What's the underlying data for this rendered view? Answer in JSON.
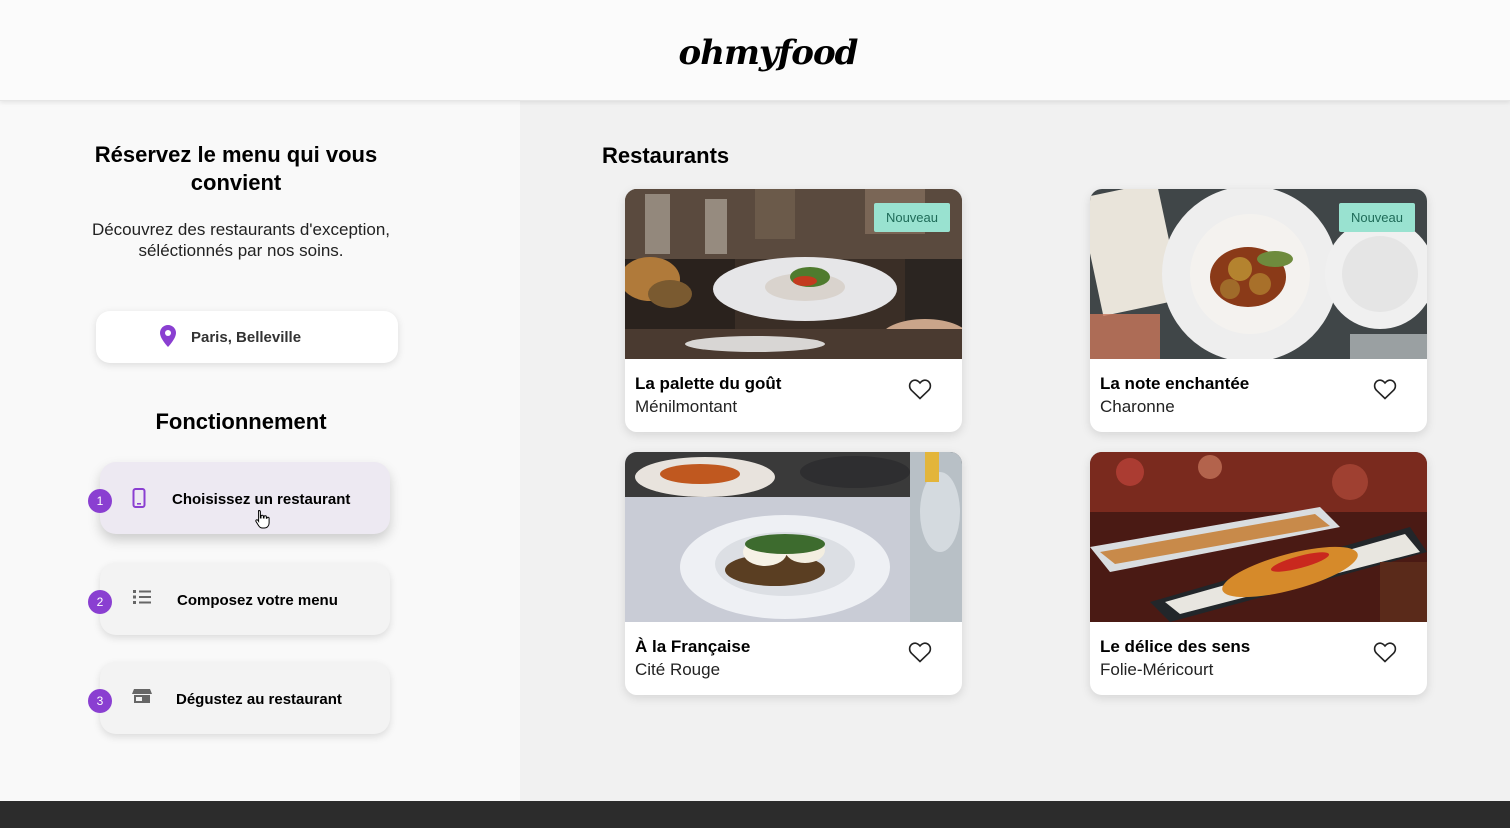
{
  "header": {
    "logo": "ohmyfood"
  },
  "hero": {
    "title": "Réservez le menu qui vous convient",
    "subtitle_line1": "Découvrez des restaurants d'exception,",
    "subtitle_line2": "séléctionnés par nos soins."
  },
  "location": {
    "label": "Paris, Belleville",
    "icon": "location-pin-icon",
    "color": "#8a3fd1"
  },
  "how_it_works": {
    "title": "Fonctionnement",
    "steps": [
      {
        "num": "1",
        "label": "Choisissez un restaurant",
        "icon": "smartphone-icon"
      },
      {
        "num": "2",
        "label": "Composez votre menu",
        "icon": "list-icon"
      },
      {
        "num": "3",
        "label": "Dégustez au restaurant",
        "icon": "store-icon"
      }
    ]
  },
  "restaurants": {
    "title": "Restaurants",
    "items": [
      {
        "name": "La palette du goût",
        "area": "Ménilmontant",
        "badge": "Nouveau",
        "photo": "restaurant-table-plate"
      },
      {
        "name": "La note enchantée",
        "area": "Charonne",
        "badge": "Nouveau",
        "photo": "plate-top-view"
      },
      {
        "name": "À la Française",
        "area": "Cité Rouge",
        "badge": "",
        "photo": "eggs-benedict-plate"
      },
      {
        "name": "Le délice des sens",
        "area": "Folie-Méricourt",
        "badge": "",
        "photo": "sushi-platter"
      }
    ]
  },
  "colors": {
    "accent": "#8a3fd1",
    "badge_bg": "#99e2d0",
    "badge_text": "#1e6b58",
    "footer": "#2c2c2c"
  }
}
